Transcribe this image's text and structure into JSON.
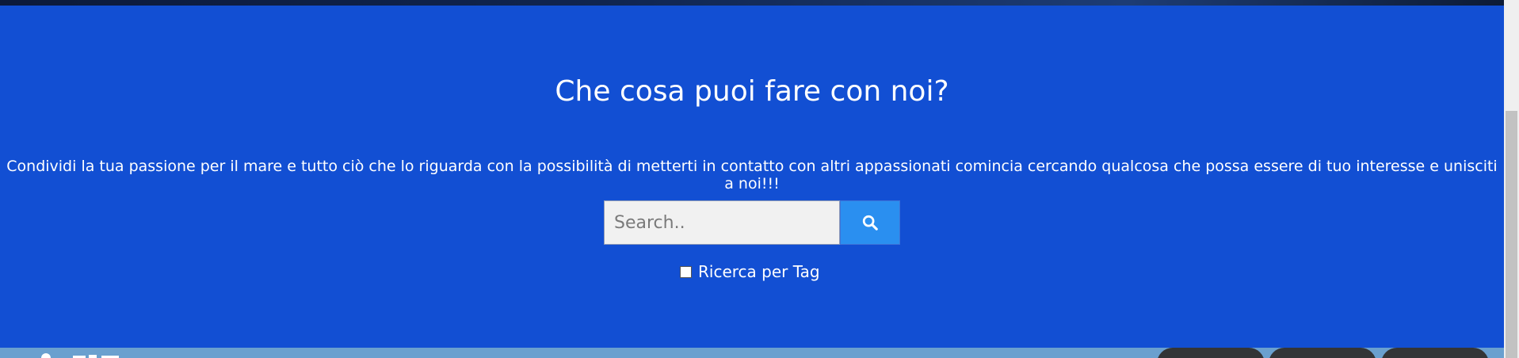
{
  "hero": {
    "title": "Che cosa puoi fare con noi?",
    "description": "Condividi la tua passione per il mare e tutto ciò che lo riguarda con la possibilità di metterti in contatto con altri appassionati comincia cercando qualcosa che possa essere di tuo interesse e unisciti a noi!!!"
  },
  "search": {
    "placeholder": "Search..",
    "value": "",
    "button_icon": "search-icon",
    "tag_checkbox_label": "Ricerca per Tag",
    "tag_checkbox_checked": false
  },
  "colors": {
    "hero_background": "#124fd3",
    "search_button": "#2a8ff0",
    "bottom_bar": "#6aa0cf",
    "pill_buttons": "#333537"
  }
}
